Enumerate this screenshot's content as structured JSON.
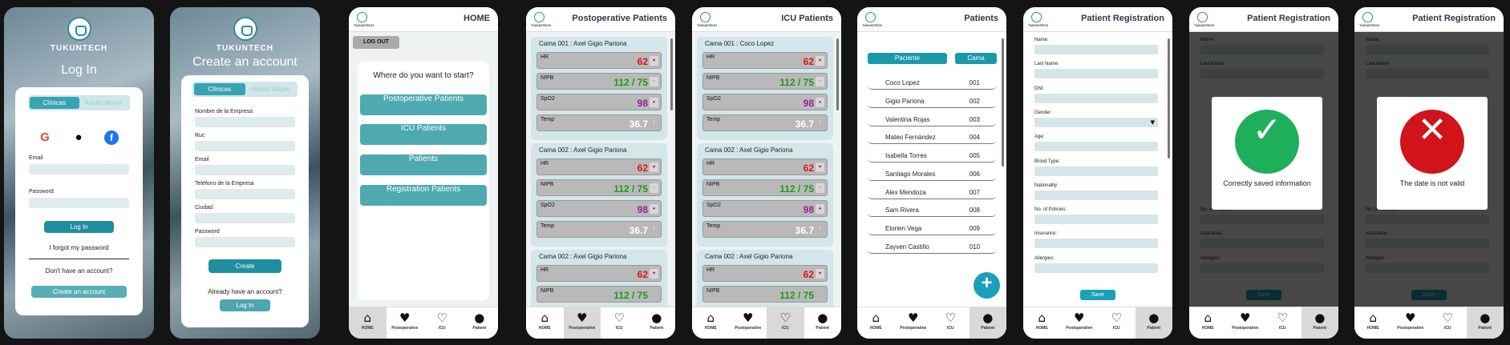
{
  "brand": "TUKUNTECH",
  "login": {
    "title": "Log In",
    "tabs": [
      "Clínicas",
      "Adulto Mayor"
    ],
    "email_label": "Email",
    "password_label": "Password",
    "login_button": "Log In",
    "forgot": "I forgot my password",
    "no_account": "Don't have an account?",
    "create_button": "Create an account"
  },
  "register_account": {
    "title": "Create an account",
    "tabs": [
      "Clínicas",
      "Adulto Mayor"
    ],
    "fields": [
      "Nombre de la Empresa",
      "Ruc",
      "Email",
      "Teléfono de la Empresa",
      "Ciudad",
      "Password"
    ],
    "create_button": "Create",
    "already": "Already have an account?",
    "login_button": "Log In"
  },
  "home": {
    "title": "HOME",
    "logout": "LOG OUT",
    "question": "Where do you want to start?",
    "buttons": [
      "Postoperative Patients",
      "ICU Patients",
      "Patients",
      "Registration Patients"
    ]
  },
  "nav": {
    "items": [
      "HOME",
      "Postoperative",
      "ICU",
      "Patient"
    ]
  },
  "postop": {
    "title": "Postoperative Patients",
    "beds": [
      {
        "name": "Cama 001 : Axel Gigio Pariona",
        "hr": "62",
        "nipb": "112 / 75",
        "spo2": "98",
        "temp": "36.7"
      },
      {
        "name": "Cama 002 : Axel Gigio Pariona",
        "hr": "62",
        "nipb": "112 / 75",
        "spo2": "98",
        "temp": "36.7"
      },
      {
        "name": "Cama 002 : Axel Gigio Pariona",
        "hr": "62",
        "nipb": "112 / 75"
      }
    ]
  },
  "icu": {
    "title": "ICU Patients",
    "beds": [
      {
        "name": "Cama 001 : Coco Lopez",
        "hr": "62",
        "nipb": "112 / 75",
        "spo2": "98",
        "temp": "36.7"
      },
      {
        "name": "Cama 002 : Axel Gigio Pariona",
        "hr": "62",
        "nipb": "112 / 75",
        "spo2": "98",
        "temp": "36.7"
      },
      {
        "name": "Cama 002 : Axel Gigio Pariona",
        "hr": "62",
        "nipb": "112 / 75"
      }
    ]
  },
  "vital_labels": {
    "hr": "HR",
    "nipb": "NIPB",
    "spo2": "SpO2",
    "temp": "Temp",
    "bpm": "bpm"
  },
  "patients": {
    "title": "Patients",
    "tab_patient": "Paciente",
    "tab_bed": "Cama",
    "rows": [
      {
        "name": "Coco Lopez",
        "bed": "001"
      },
      {
        "name": "Gigio Pariona",
        "bed": "002"
      },
      {
        "name": "Valentina Rojas",
        "bed": "003"
      },
      {
        "name": "Mateo Fernández",
        "bed": "004"
      },
      {
        "name": "Isabella Torres",
        "bed": "005"
      },
      {
        "name": "Santiago Morales",
        "bed": "006"
      },
      {
        "name": "Alex Mendoza",
        "bed": "007"
      },
      {
        "name": "Sam Rivera",
        "bed": "008"
      },
      {
        "name": "Elorien Vega",
        "bed": "009"
      },
      {
        "name": "Zayven Castillo",
        "bed": "010"
      }
    ],
    "fab": "+"
  },
  "registration": {
    "title": "Patient Registration",
    "fields": [
      "Name:",
      "Last Name:",
      "DNI:",
      "Gender:",
      "Age:",
      "Blood Type:",
      "Nationality:",
      "No. of Policies:",
      "Insurance:",
      "Allergies:"
    ],
    "save": "Save"
  },
  "modal_success": {
    "text": "Correctly saved information",
    "icon": "check-icon",
    "color": "#1fae5a"
  },
  "modal_error": {
    "text": "The date is not valid",
    "icon": "x-icon",
    "color": "#d0141a"
  },
  "colors": {
    "accent": "#37a3b3",
    "red": "#e2101a",
    "green": "#1e9a14",
    "purple": "#9b1c9f"
  }
}
